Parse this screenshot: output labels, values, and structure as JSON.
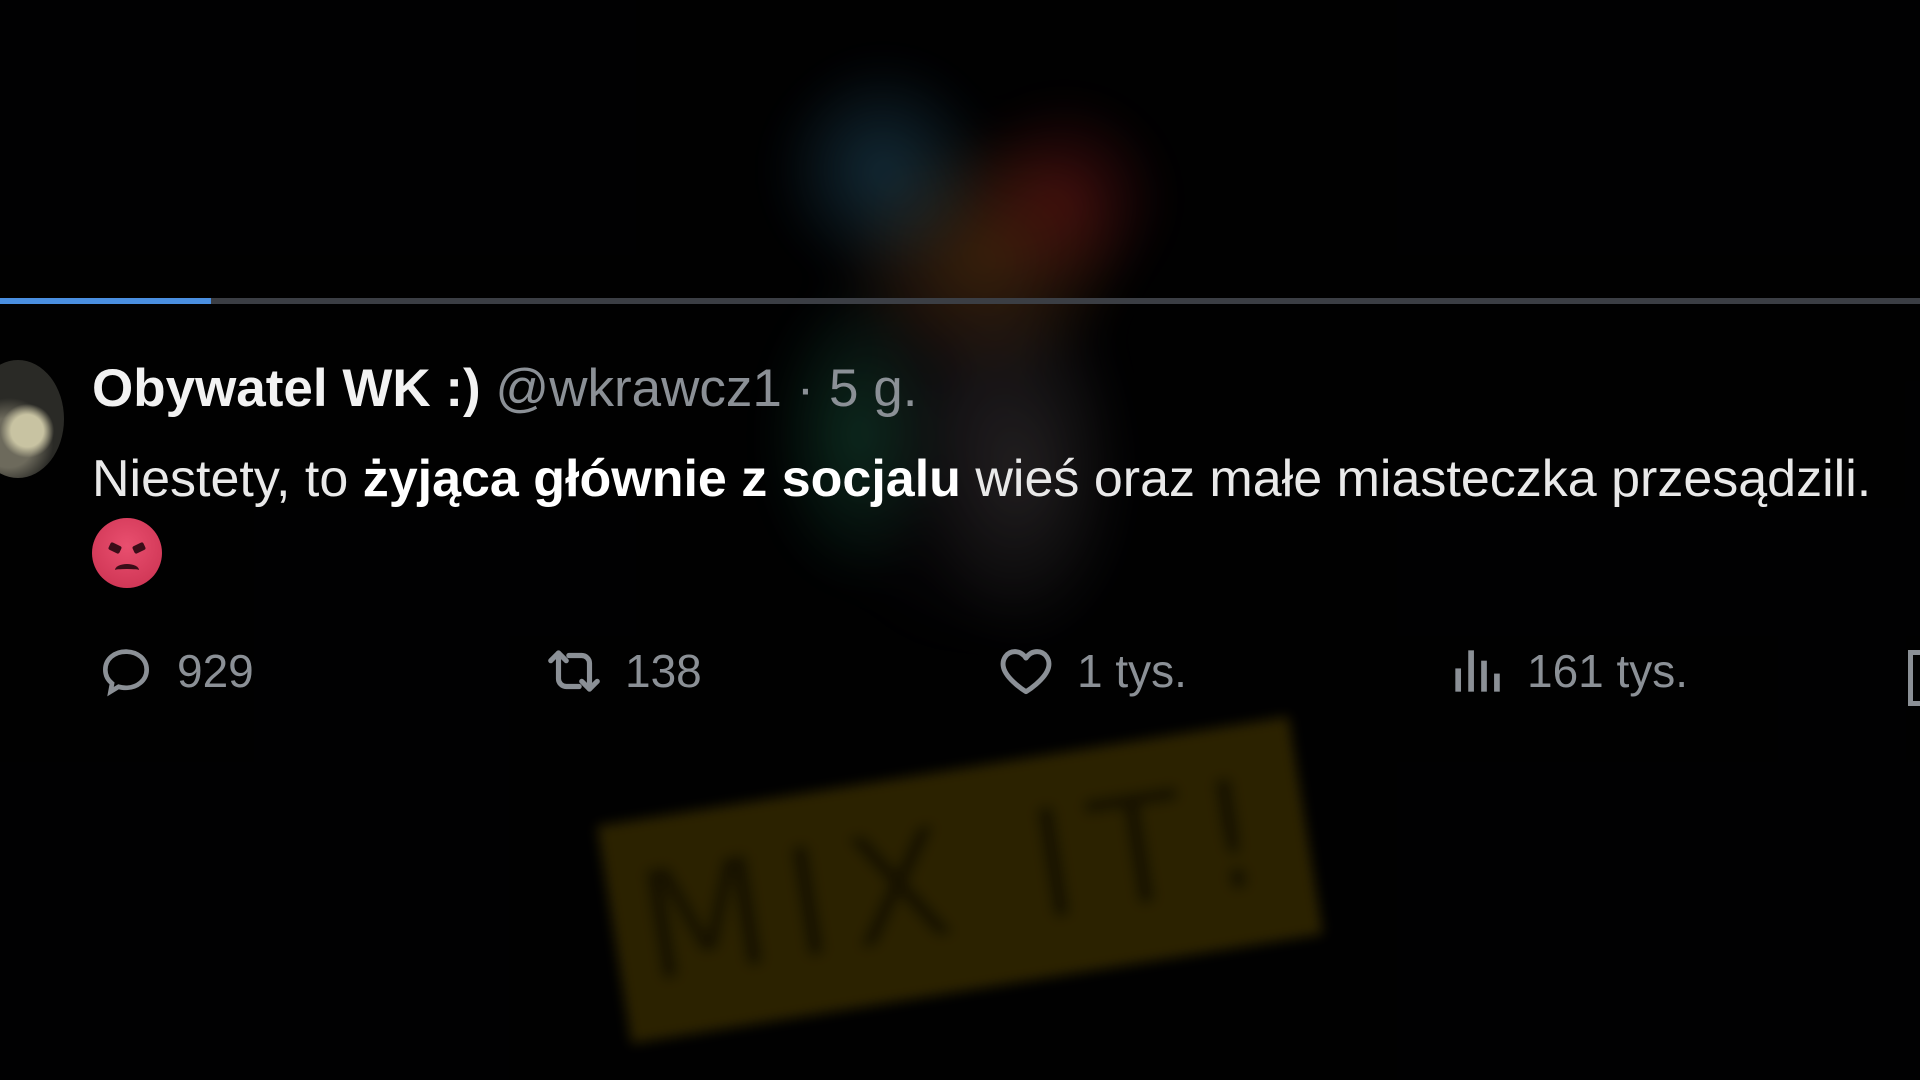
{
  "watermark": {
    "text": "MIX IT!"
  },
  "progress": {
    "fraction": 0.11,
    "color": "#4a8fe0"
  },
  "tweet": {
    "author_name": "Obywatel WK :)",
    "handle": "@wkrawcz1",
    "separator": "·",
    "time": "5 g.",
    "text_before": "Niestety, to ",
    "text_bold": "żyjąca głównie z socjalu",
    "text_after": " wieś oraz małe miasteczka przesądzili. ",
    "emoji": "angry-face-emoji"
  },
  "actions": {
    "replies": "929",
    "retweets": "138",
    "likes": "1 tys.",
    "views": "161 tys."
  },
  "icons": {
    "reply": "reply-icon",
    "retweet": "retweet-icon",
    "like": "heart-icon",
    "views": "views-icon",
    "bookmark": "bookmark-icon"
  },
  "colors": {
    "background": "#000000",
    "text_primary": "#e9e9e9",
    "text_secondary": "#8b9096",
    "accent_blue": "#4a8fe0",
    "emoji_red": "#e94f6f"
  }
}
